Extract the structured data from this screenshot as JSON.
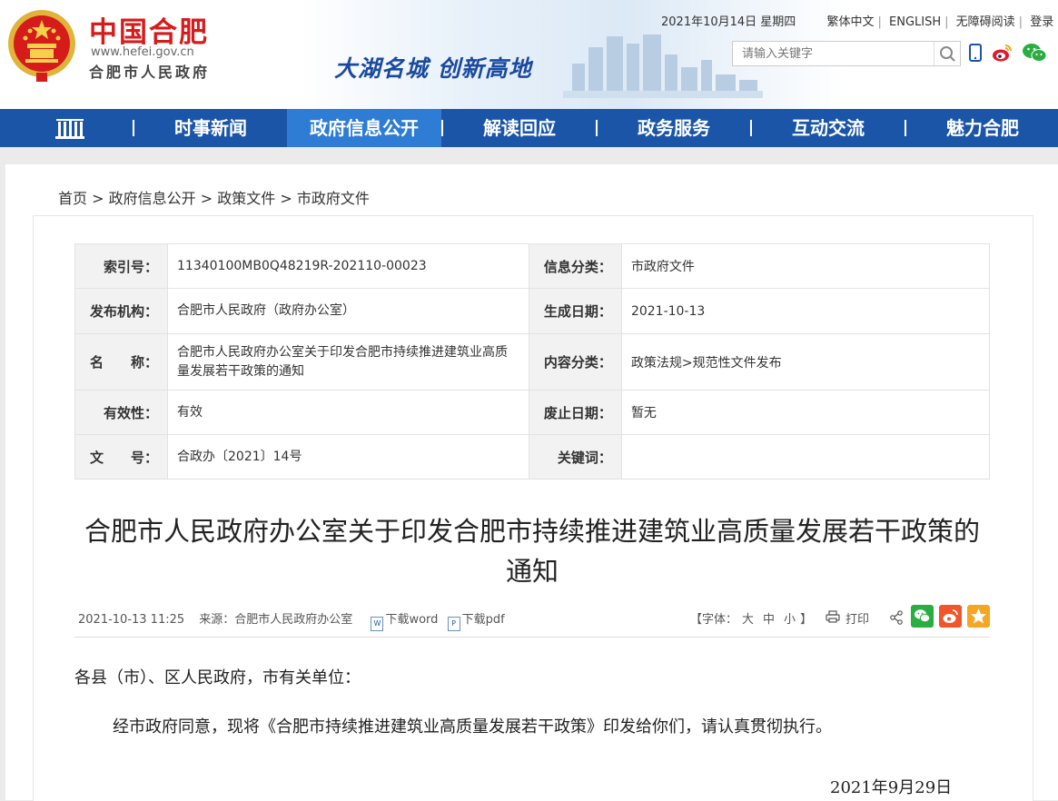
{
  "header": {
    "site_name": "中国合肥",
    "site_url": "www.hefei.gov.cn",
    "site_org": "合肥市人民政府",
    "slogan": "大湖名城 创新高地",
    "date": "2021年10月14日 星期四",
    "links": [
      "繁体中文",
      "ENGLISH",
      "无障碍阅读",
      "登录"
    ],
    "search_placeholder": "请输入关键字"
  },
  "nav": {
    "items": [
      "时事新闻",
      "政府信息公开",
      "解读回应",
      "政务服务",
      "互动交流",
      "魅力合肥"
    ],
    "active_index": 1
  },
  "breadcrumb": [
    "首页",
    "政府信息公开",
    "政策文件",
    "市政府文件"
  ],
  "breadcrumb_sep": ">",
  "info": {
    "index_label": "索引号：",
    "index_value": "11340100MB0Q48219R-202110-00023",
    "category_label": "信息分类：",
    "category_value": "市政府文件",
    "publisher_label": "发布机构：",
    "publisher_value": "合肥市人民政府（政府办公室）",
    "created_label": "生成日期：",
    "created_value": "2021-10-13",
    "name_label": "名　　称：",
    "name_value": "合肥市人民政府办公室关于印发合肥市持续推进建筑业高质量发展若干政策的通知",
    "content_label": "内容分类：",
    "content_value": "政策法规>规范性文件发布",
    "validity_label": "有效性：",
    "validity_value": "有效",
    "abolish_label": "废止日期：",
    "abolish_value": "暂无",
    "docno_label": "文　　号：",
    "docno_value": "合政办〔2021〕14号",
    "keywords_label": "关键词：",
    "keywords_value": ""
  },
  "article": {
    "title": "合肥市人民政府办公室关于印发合肥市持续推进建筑业高质量发展若干政策的通知",
    "datetime": "2021-10-13 11:25",
    "source": "来源：合肥市人民政府办公室",
    "download_word": "下载word",
    "download_pdf": "下载pdf",
    "font_label_open": "【字体：",
    "font_sizes": [
      "大",
      "中",
      "小"
    ],
    "font_label_close": "】",
    "print": "打印",
    "salutation": "各县（市）、区人民政府，市有关单位：",
    "body": "经市政府同意，现将《合肥市持续推进建筑业高质量发展若干政策》印发给你们，请认真贯彻执行。",
    "sign_date": "2021年9月29日"
  },
  "colors": {
    "nav_bg": "#1a55a8",
    "nav_active": "#2e7cd3",
    "brand_red": "#d61b1b",
    "wechat_green": "#2aae41",
    "weibo_orange": "#f0562a",
    "star_orange": "#f5a623"
  },
  "icons": [
    "emblem-icon",
    "search-icon",
    "phone-icon",
    "weibo-icon",
    "wechat-icon",
    "home-icon",
    "word-icon",
    "pdf-icon",
    "print-icon",
    "share-icon",
    "star-icon"
  ]
}
